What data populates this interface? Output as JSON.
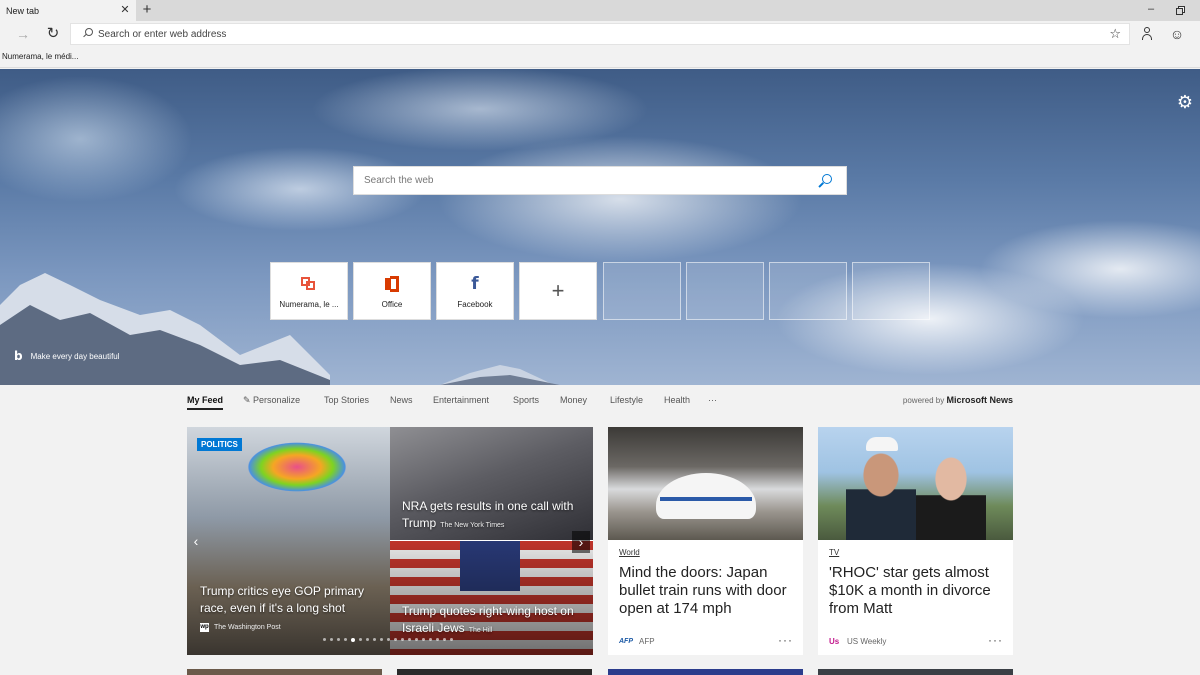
{
  "tab": {
    "title": "New tab"
  },
  "address_bar": {
    "placeholder": "Search or enter web address"
  },
  "favorites": [
    {
      "label": "Numerama, le médi..."
    }
  ],
  "hero": {
    "search_placeholder": "Search the web",
    "tiles": [
      {
        "label": "Numerama, le ..."
      },
      {
        "label": "Office"
      },
      {
        "label": "Facebook"
      }
    ],
    "bing_caption": "Make every day beautiful"
  },
  "feed_nav": {
    "items": [
      "My Feed",
      "Personalize",
      "Top Stories",
      "News",
      "Entertainment",
      "Sports",
      "Money",
      "Lifestyle",
      "Health",
      "···"
    ],
    "powered_prefix": "powered by",
    "powered_brand": "Microsoft News"
  },
  "big_card": {
    "badge": "POLITICS",
    "main": {
      "headline": "Trump critics eye GOP primary race, even if it's a long shot",
      "source": "The Washington Post",
      "source_logo": "wp"
    },
    "top_right": {
      "headline": "NRA gets results in one call with Trump",
      "source": "The New York Times"
    },
    "bottom_right": {
      "headline": "Trump quotes right-wing host on Israeli Jews",
      "source": "The Hill"
    },
    "carousel": {
      "count": 19,
      "active": 4
    }
  },
  "cards": [
    {
      "category": "World",
      "headline": "Mind the doors: Japan bullet train runs with door open at 174 mph",
      "source": "AFP",
      "source_logo": "AFP",
      "more": "···"
    },
    {
      "category": "TV",
      "headline": "'RHOC' star gets almost $10K a month in divorce from Matt",
      "source": "US Weekly",
      "source_logo": "Us",
      "more": "···"
    }
  ],
  "icons": {
    "close": "close-icon",
    "new_tab": "plus-icon",
    "forward": "arrow-right-icon",
    "refresh": "refresh-icon",
    "favorite": "star-icon",
    "profile": "person-icon",
    "feedback": "smiley-icon",
    "settings": "gear-icon"
  },
  "colors": {
    "accent": "#0078d4",
    "numerama": "#e8543b",
    "office": "#d83b01",
    "facebook": "#3b5998"
  }
}
